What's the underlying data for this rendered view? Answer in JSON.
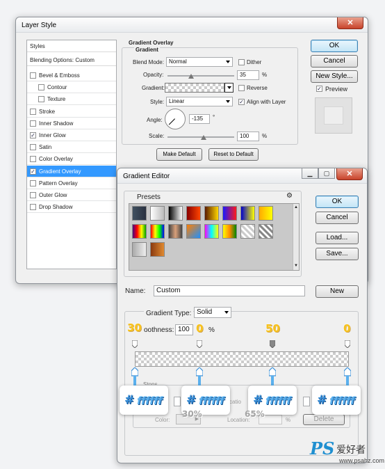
{
  "layer_style": {
    "title": "Layer Style",
    "styles_header": "Styles",
    "blending_options": "Blending Options: Custom",
    "items": [
      {
        "label": "Bevel & Emboss",
        "checked": false
      },
      {
        "label": "Contour",
        "checked": false
      },
      {
        "label": "Texture",
        "checked": false
      },
      {
        "label": "Stroke",
        "checked": false
      },
      {
        "label": "Inner Shadow",
        "checked": false
      },
      {
        "label": "Inner Glow",
        "checked": true
      },
      {
        "label": "Satin",
        "checked": false
      },
      {
        "label": "Color Overlay",
        "checked": false
      },
      {
        "label": "Gradient Overlay",
        "checked": true
      },
      {
        "label": "Pattern Overlay",
        "checked": false
      },
      {
        "label": "Outer Glow",
        "checked": false
      },
      {
        "label": "Drop Shadow",
        "checked": false
      }
    ],
    "section_title": "Gradient Overlay",
    "group_title": "Gradient",
    "blend_mode_label": "Blend Mode:",
    "blend_mode_value": "Normal",
    "dither_label": "Dither",
    "opacity_label": "Opacity:",
    "opacity_value": "35",
    "opacity_level": 0.35,
    "percent": "%",
    "gradient_label": "Gradient:",
    "reverse_label": "Reverse",
    "style_label": "Style:",
    "style_value": "Linear",
    "align_label": "Align with Layer",
    "align_checked": true,
    "angle_label": "Angle:",
    "angle_value": "-135",
    "degree": "°",
    "scale_label": "Scale:",
    "scale_value": "100",
    "make_default": "Make Default",
    "reset_default": "Reset to Default",
    "ok": "OK",
    "cancel": "Cancel",
    "new_style": "New Style...",
    "preview_label": "Preview",
    "preview_checked": true
  },
  "gradient_editor": {
    "title": "Gradient Editor",
    "presets_label": "Presets",
    "ok": "OK",
    "cancel": "Cancel",
    "load": "Load...",
    "save": "Save...",
    "name_label": "Name:",
    "name_value": "Custom",
    "new_button": "New",
    "gradient_type_label": "Gradient Type:",
    "gradient_type_value": "Solid",
    "smoothness_label": "oothness:",
    "smoothness_value": "100",
    "percent": "%",
    "stops_label": "Stops",
    "color_label": "Color:",
    "location_label": "Location:",
    "location_partial": "catio",
    "delete_label": "Delete"
  },
  "annotations": {
    "opacity_top": [
      "30",
      "0",
      "50",
      "0"
    ],
    "hex_values": [
      "ffffff",
      "ffffff",
      "ffffff",
      "ffffff"
    ],
    "hash": "#",
    "location_bottom": [
      "30%",
      "65%"
    ]
  },
  "watermark": {
    "logo": "PS",
    "cn_text": "爱好者",
    "url": "www.psahz.com"
  },
  "colors": {
    "accent": "#3399ff",
    "annotation_gold": "#f7c21c",
    "annotation_blue": "#3a8fd8"
  }
}
